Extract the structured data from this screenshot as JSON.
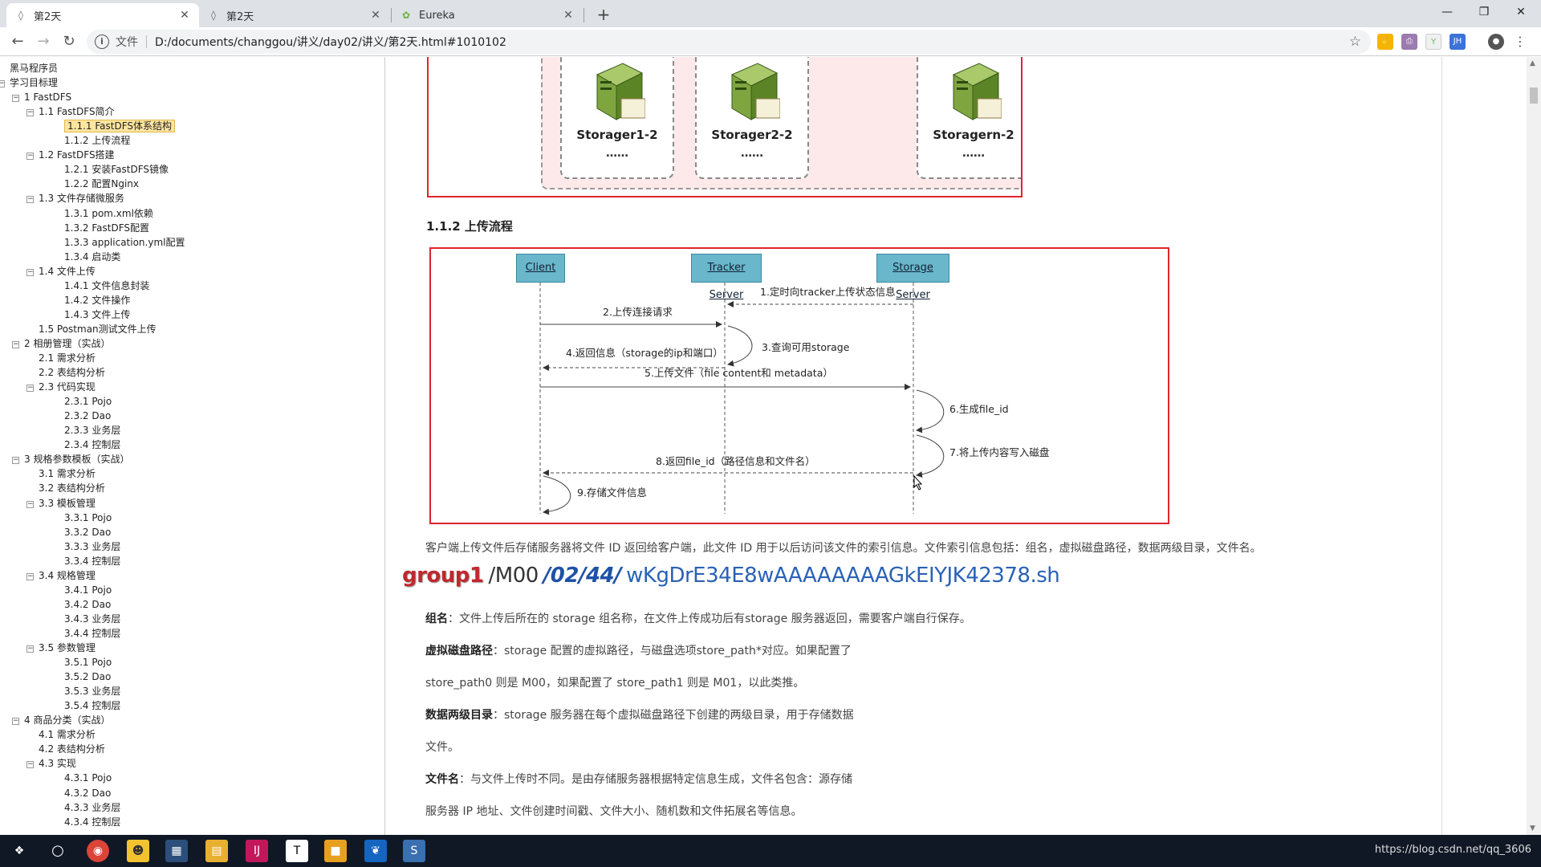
{
  "browser": {
    "tabs": [
      {
        "title": "第2天",
        "favicon": "document-icon",
        "active": true
      },
      {
        "title": "第2天",
        "favicon": "document-icon",
        "active": false
      },
      {
        "title": "Eureka",
        "favicon": "leaf-icon",
        "active": false
      }
    ],
    "new_tab_label": "+",
    "address": {
      "scheme_label": "文件",
      "url": "D:/documents/changgou/讲义/day02/讲义/第2天.html#1010102"
    },
    "window_controls": [
      "minimize-icon",
      "restore-icon",
      "close-icon"
    ]
  },
  "sidebar": {
    "items": [
      {
        "label": "黑马程序员",
        "level": 0,
        "toggle": ""
      },
      {
        "label": "学习目标理",
        "level": 0,
        "toggle": "-"
      },
      {
        "label": "1 FastDFS",
        "level": 1,
        "toggle": "-"
      },
      {
        "label": "1.1 FastDFS简介",
        "level": 2,
        "toggle": "-"
      },
      {
        "label": "1.1.1 FastDFS体系结构",
        "level": 3,
        "toggle": "",
        "selected": true
      },
      {
        "label": "1.1.2 上传流程",
        "level": 3,
        "toggle": ""
      },
      {
        "label": "1.2 FastDFS搭建",
        "level": 2,
        "toggle": "-"
      },
      {
        "label": "1.2.1 安装FastDFS镜像",
        "level": 3,
        "toggle": ""
      },
      {
        "label": "1.2.2 配置Nginx",
        "level": 3,
        "toggle": ""
      },
      {
        "label": "1.3 文件存储微服务",
        "level": 2,
        "toggle": "-"
      },
      {
        "label": "1.3.1 pom.xml依赖",
        "level": 3,
        "toggle": ""
      },
      {
        "label": "1.3.2 FastDFS配置",
        "level": 3,
        "toggle": ""
      },
      {
        "label": "1.3.3 application.yml配置",
        "level": 3,
        "toggle": ""
      },
      {
        "label": "1.3.4 启动类",
        "level": 3,
        "toggle": ""
      },
      {
        "label": "1.4 文件上传",
        "level": 2,
        "toggle": "-"
      },
      {
        "label": "1.4.1 文件信息封装",
        "level": 3,
        "toggle": ""
      },
      {
        "label": "1.4.2 文件操作",
        "level": 3,
        "toggle": ""
      },
      {
        "label": "1.4.3 文件上传",
        "level": 3,
        "toggle": ""
      },
      {
        "label": "1.5 Postman测试文件上传",
        "level": 2,
        "toggle": ""
      },
      {
        "label": "2 相册管理（实战）",
        "level": 1,
        "toggle": "-"
      },
      {
        "label": "2.1 需求分析",
        "level": 2,
        "toggle": ""
      },
      {
        "label": "2.2 表结构分析",
        "level": 2,
        "toggle": ""
      },
      {
        "label": "2.3 代码实现",
        "level": 2,
        "toggle": "-"
      },
      {
        "label": "2.3.1 Pojo",
        "level": 3,
        "toggle": ""
      },
      {
        "label": "2.3.2 Dao",
        "level": 3,
        "toggle": ""
      },
      {
        "label": "2.3.3 业务层",
        "level": 3,
        "toggle": ""
      },
      {
        "label": "2.3.4 控制层",
        "level": 3,
        "toggle": ""
      },
      {
        "label": "3 规格参数模板（实战）",
        "level": 1,
        "toggle": "-"
      },
      {
        "label": "3.1 需求分析",
        "level": 2,
        "toggle": ""
      },
      {
        "label": "3.2 表结构分析",
        "level": 2,
        "toggle": ""
      },
      {
        "label": "3.3 模板管理",
        "level": 2,
        "toggle": "-"
      },
      {
        "label": "3.3.1 Pojo",
        "level": 3,
        "toggle": ""
      },
      {
        "label": "3.3.2 Dao",
        "level": 3,
        "toggle": ""
      },
      {
        "label": "3.3.3 业务层",
        "level": 3,
        "toggle": ""
      },
      {
        "label": "3.3.4 控制层",
        "level": 3,
        "toggle": ""
      },
      {
        "label": "3.4 规格管理",
        "level": 2,
        "toggle": "-"
      },
      {
        "label": "3.4.1 Pojo",
        "level": 3,
        "toggle": ""
      },
      {
        "label": "3.4.2 Dao",
        "level": 3,
        "toggle": ""
      },
      {
        "label": "3.4.3 业务层",
        "level": 3,
        "toggle": ""
      },
      {
        "label": "3.4.4 控制层",
        "level": 3,
        "toggle": ""
      },
      {
        "label": "3.5 参数管理",
        "level": 2,
        "toggle": "-"
      },
      {
        "label": "3.5.1 Pojo",
        "level": 3,
        "toggle": ""
      },
      {
        "label": "3.5.2 Dao",
        "level": 3,
        "toggle": ""
      },
      {
        "label": "3.5.3 业务层",
        "level": 3,
        "toggle": ""
      },
      {
        "label": "3.5.4 控制层",
        "level": 3,
        "toggle": ""
      },
      {
        "label": "4 商品分类（实战）",
        "level": 1,
        "toggle": "-"
      },
      {
        "label": "4.1 需求分析",
        "level": 2,
        "toggle": ""
      },
      {
        "label": "4.2 表结构分析",
        "level": 2,
        "toggle": ""
      },
      {
        "label": "4.3 实现",
        "level": 2,
        "toggle": "-"
      },
      {
        "label": "4.3.1 Pojo",
        "level": 3,
        "toggle": ""
      },
      {
        "label": "4.3.2 Dao",
        "level": 3,
        "toggle": ""
      },
      {
        "label": "4.3.3 业务层",
        "level": 3,
        "toggle": ""
      },
      {
        "label": "4.3.4 控制层",
        "level": 3,
        "toggle": ""
      }
    ]
  },
  "content": {
    "storage_diagram": {
      "servers": [
        {
          "label": "Storager1-2",
          "dots": "……"
        },
        {
          "label": "Storager2-2",
          "dots": "……"
        },
        {
          "label": "Storagern-2",
          "dots": "……"
        }
      ]
    },
    "section_heading": "1.1.2 上传流程",
    "sequence_diagram": {
      "actors": [
        "Client",
        "Tracker Server",
        "Storage Server"
      ],
      "messages": [
        "1.定时向tracker上传状态信息",
        "2.上传连接请求",
        "3.查询可用storage",
        "4.返回信息（storage的ip和端口）",
        "5.上传文件（file content和 metadata）",
        "6.生成file_id",
        "7.将上传内容写入磁盘",
        "8.返回file_id（路径信息和文件名）",
        "9.存储文件信息"
      ]
    },
    "intro_paragraph": "客户端上传文件后存储服务器将文件 ID 返回给客户端，此文件 ID 用于以后访问该文件的索引信息。文件索引信息包括：组名，虚拟磁盘路径，数据两级目录，文件名。",
    "path_example": {
      "group": "group1",
      "m00": "/M00",
      "dirs": "/02/44/",
      "filename": "wKgDrE34E8wAAAAAAAAGkEIYJK42378.sh"
    },
    "definitions": [
      {
        "term": "组名",
        "text": "：文件上传后所在的 storage 组名称，在文件上传成功后有storage 服务器返回，需要客户端自行保存。"
      },
      {
        "term": "虚拟磁盘路径",
        "text": "：storage 配置的虚拟路径，与磁盘选项store_path*对应。如果配置了"
      },
      {
        "term": "",
        "text": "store_path0 则是 M00，如果配置了 store_path1 则是 M01，以此类推。"
      },
      {
        "term": "数据两级目录",
        "text": "：storage 服务器在每个虚拟磁盘路径下创建的两级目录，用于存储数据"
      },
      {
        "term": "",
        "text": "文件。"
      },
      {
        "term": "文件名",
        "text": "：与文件上传时不同。是由存储服务器根据特定信息生成，文件名包含：源存储"
      },
      {
        "term": "",
        "text": "服务器 IP 地址、文件创建时间戳、文件大小、随机数和文件拓展名等信息。"
      }
    ]
  },
  "taskbar": {
    "apps": [
      "windows-start-icon",
      "cortana-icon",
      "chrome-icon",
      "game-icon",
      "screenshot-icon",
      "folder-icon",
      "intellij-icon",
      "typora-icon",
      "app-icon",
      "feather-icon",
      "sublime-icon"
    ],
    "tray_text": "https://blog.csdn.net/qq_3606"
  },
  "colors": {
    "accent_red": "#e0242c",
    "actor_blue": "#6ab7cc",
    "path_blue": "#2a62b5",
    "selected_toc": "#ffe6a0"
  }
}
